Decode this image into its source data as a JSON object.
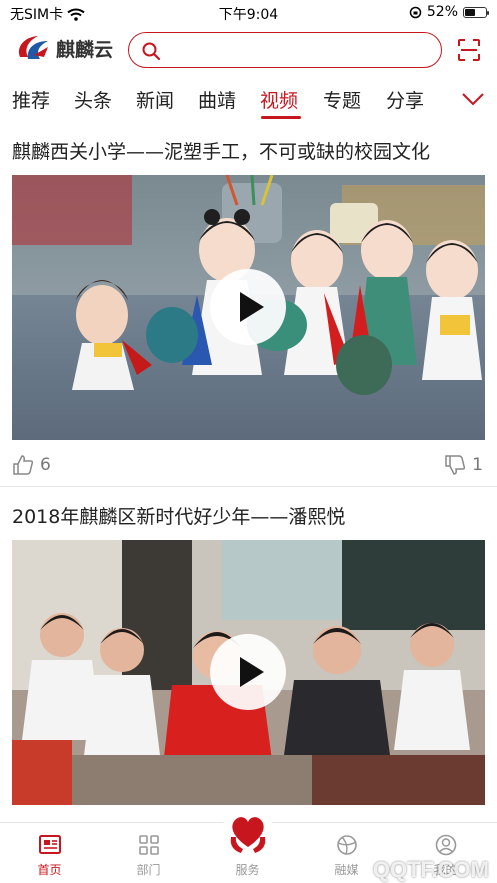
{
  "status_bar": {
    "carrier": "无SIM卡",
    "time": "下午9:04",
    "battery_percent": "52%",
    "battery_level": 0.52
  },
  "header": {
    "app_name": "麒麟云",
    "search_placeholder": ""
  },
  "tabs": [
    "推荐",
    "头条",
    "新闻",
    "曲靖",
    "视频",
    "专题",
    "分享"
  ],
  "active_tab": "视频",
  "feed": [
    {
      "title": "麒麟西关小学——泥塑手工，不可或缺的校园文化",
      "likes": "6",
      "dislikes": "1"
    },
    {
      "title": "2018年麒麟区新时代好少年——潘熙悦",
      "likes": "",
      "dislikes": ""
    }
  ],
  "bottom_nav": [
    {
      "label": "首页",
      "icon": "news-icon",
      "active": true
    },
    {
      "label": "部门",
      "icon": "grid-icon",
      "active": false
    },
    {
      "label": "服务",
      "icon": "service-heart-icon",
      "active": false
    },
    {
      "label": "融媒",
      "icon": "globe-icon",
      "active": false
    },
    {
      "label": "我的",
      "icon": "user-icon",
      "active": false
    }
  ],
  "watermark": "QQTF.COM",
  "colors": {
    "brand_red": "#c8161e",
    "text_dark": "#222222",
    "text_muted": "#777777"
  }
}
